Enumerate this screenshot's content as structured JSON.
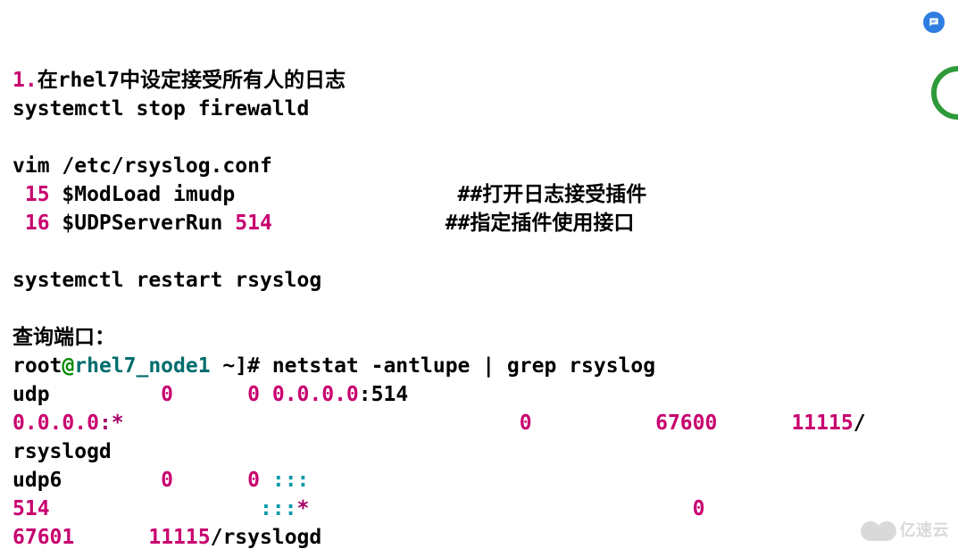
{
  "step_number": "1.",
  "step_title": "在rhel7中设定接受所有人的日志",
  "cmd_stop_firewall": "systemctl stop firewalld",
  "cmd_vim": "vim /etc/rsyslog.conf",
  "vim_line15_num": " 15",
  "vim_line15_txt": " $ModLoad imudp",
  "vim_line15_comment": "##打开日志接受插件",
  "vim_line16_num": " 16",
  "vim_line16_txt": " $UDPServerRun ",
  "vim_line16_val": "514",
  "vim_line16_comment": "##指定插件使用接口",
  "cmd_restart": "systemctl restart rsyslog",
  "query_label": "查询端口：",
  "prompt_user": "root",
  "prompt_at": "@",
  "prompt_host": "rhel7_node1",
  "prompt_tail": " ~]# ",
  "cmd_netstat": "netstat -antlupe | grep rsyslog",
  "out1_proto": "udp",
  "out1_recv": "0",
  "out1_send": "0",
  "out1_local": "0.0.0.0",
  "out1_local_port": ":514",
  "out1_foreign": "0.0.0.0",
  "out1_foreign_star": ":*",
  "out1_state_pad": "                  ",
  "out1_userpad": "0",
  "out1_inode": "67600",
  "out1_pid": "11115",
  "out1_prog": "/",
  "out1_progname": "rsyslogd",
  "out2_proto": "udp6",
  "out2_recv": "0",
  "out2_send": "0",
  "out2_local": ":::",
  "out2_port": "514",
  "out2_foreign": ":::",
  "out2_star": "*",
  "out2_zero": "0",
  "out2_inode": "67601",
  "out2_pid": "11115",
  "out2_slash": "/",
  "out2_prog": "rsyslogd",
  "watermark_text": "亿速云"
}
